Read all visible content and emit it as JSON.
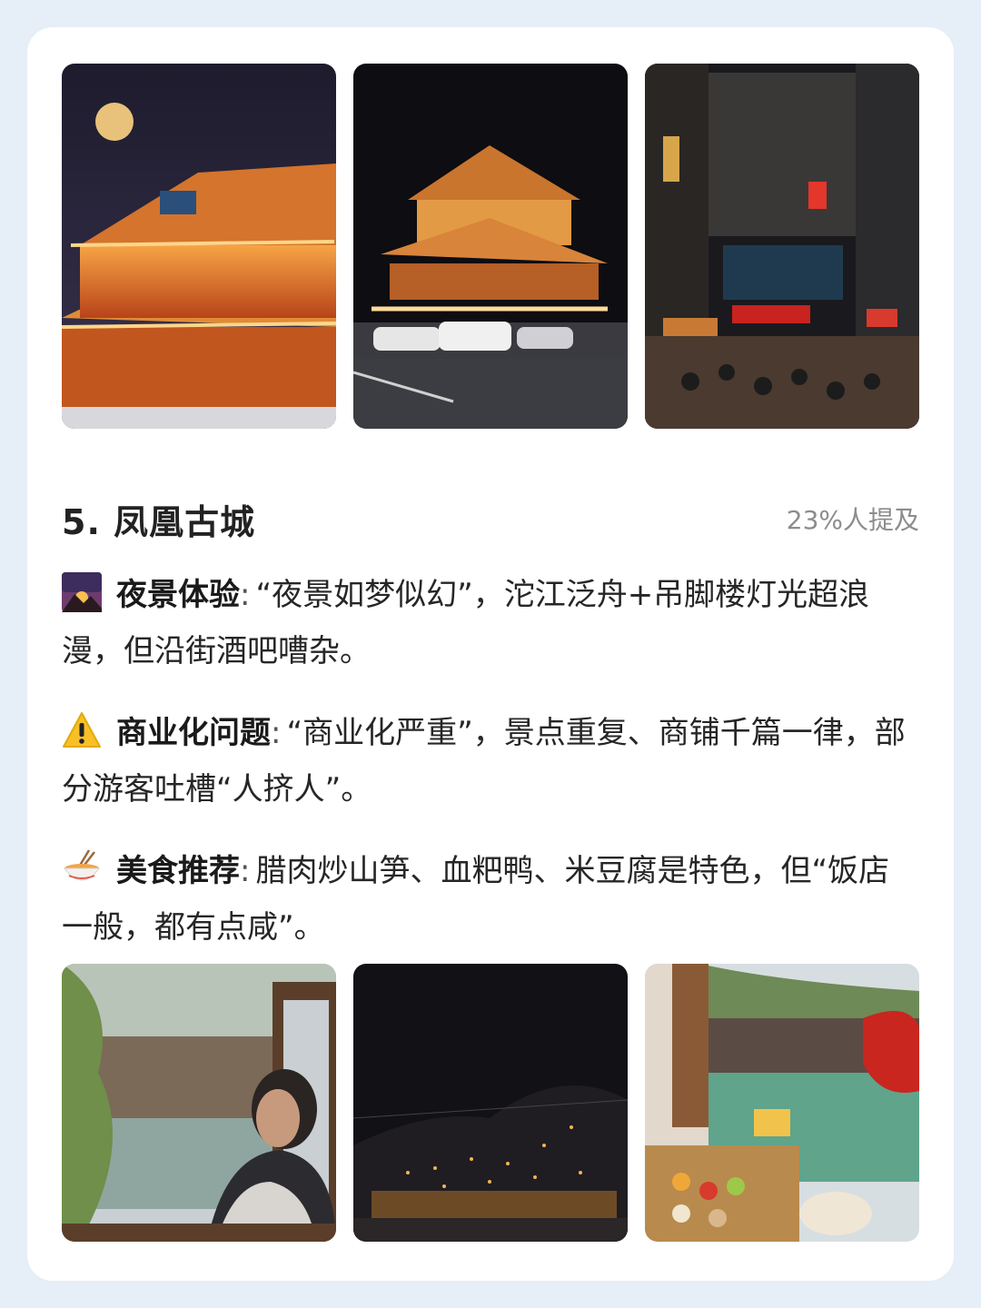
{
  "section": {
    "number": "5.",
    "name": "凤凰古城",
    "title": "5. 凤凰古城",
    "mention_rate": "23%人提及"
  },
  "items": [
    {
      "icon": "sunset-icon",
      "label": "夜景体验",
      "text": "“夜景如梦似幻”，沱江泛舟+吊脚楼灯光超浪漫，但沿街酒吧嘈杂。"
    },
    {
      "icon": "warning-icon",
      "label": "商业化问题",
      "text": "“商业化严重”，景点重复、商铺千篇一律，部分游客吐槽“人挤人”。"
    },
    {
      "icon": "noodle-bowl-icon",
      "label": "美食推荐",
      "text": "腊肉炒山笋、血粑鸭、米豆腐是特色，但“饭店一般，都有点咸”。"
    }
  ],
  "colors": {
    "background": "#e6eef8",
    "card": "#ffffff",
    "muted": "#8c8c8c"
  }
}
